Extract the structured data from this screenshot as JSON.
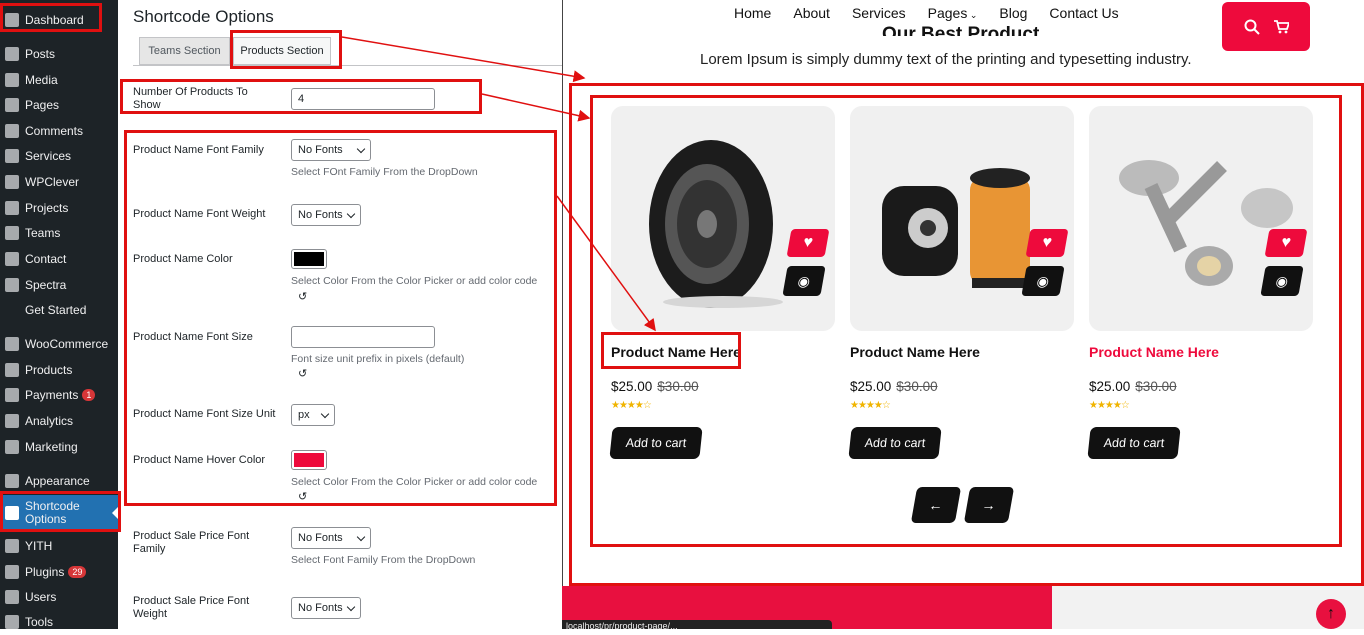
{
  "sidebar": {
    "items": [
      {
        "label": "Dashboard",
        "badge": ""
      },
      {
        "label": "Posts",
        "badge": ""
      },
      {
        "label": "Media",
        "badge": ""
      },
      {
        "label": "Pages",
        "badge": ""
      },
      {
        "label": "Comments",
        "badge": ""
      },
      {
        "label": "Services",
        "badge": ""
      },
      {
        "label": "WPClever",
        "badge": ""
      },
      {
        "label": "Projects",
        "badge": ""
      },
      {
        "label": "Teams",
        "badge": ""
      },
      {
        "label": "Contact",
        "badge": ""
      },
      {
        "label": "Spectra",
        "badge": ""
      },
      {
        "label": "Get Started",
        "badge": ""
      },
      {
        "label": "WooCommerce",
        "badge": ""
      },
      {
        "label": "Products",
        "badge": ""
      },
      {
        "label": "Payments",
        "badge": "1"
      },
      {
        "label": "Analytics",
        "badge": ""
      },
      {
        "label": "Marketing",
        "badge": ""
      },
      {
        "label": "Appearance",
        "badge": ""
      },
      {
        "label": "Shortcode Options",
        "badge": ""
      },
      {
        "label": "YITH",
        "badge": ""
      },
      {
        "label": "Plugins",
        "badge": "29"
      },
      {
        "label": "Users",
        "badge": ""
      },
      {
        "label": "Tools",
        "badge": ""
      }
    ]
  },
  "settings": {
    "title": "Shortcode Options",
    "tabs": [
      "Teams Section",
      "Products Section"
    ],
    "fields": {
      "num_products": {
        "label": "Number Of Products To Show",
        "value": "4"
      },
      "name_font_family": {
        "label": "Product Name Font Family",
        "value": "No Fonts",
        "help": "Select FOnt Family From the DropDown"
      },
      "name_font_weight": {
        "label": "Product Name Font Weight",
        "value": "No Fonts"
      },
      "name_color": {
        "label": "Product Name Color",
        "color": "#000000",
        "help": "Select Color From the Color Picker or add color code",
        "reset": "↺"
      },
      "name_font_size": {
        "label": "Product Name Font Size",
        "value": "",
        "help": "Font size unit prefix in pixels (default)",
        "reset": "↺"
      },
      "name_font_size_unit": {
        "label": "Product Name Font Size Unit",
        "value": "px"
      },
      "name_hover_color": {
        "label": "Product Name Hover Color",
        "color": "#ee0a3c",
        "help": "Select Color From the Color Picker or add color code",
        "reset": "↺"
      },
      "sale_font_family": {
        "label": "Product Sale Price Font Family",
        "value": "No Fonts",
        "help": "Select Font Family From the DropDown"
      },
      "sale_font_weight": {
        "label": "Product Sale Price Font Weight",
        "value": "No Fonts"
      }
    }
  },
  "preview": {
    "nav": [
      "Home",
      "About",
      "Services",
      "Pages",
      "Blog",
      "Contact Us"
    ],
    "nav_dropdown_icon": "chevron-down-icon",
    "section_title": "Our Best Product",
    "section_subtitle": "Lorem Ipsum is simply dummy text of the printing and typesetting industry.",
    "products": [
      {
        "name": "Product Name Here",
        "price": "$25.00",
        "old_price": "$30.00",
        "stars": "★★★★☆",
        "cart": "Add to cart",
        "name_color": "#111111"
      },
      {
        "name": "Product Name Here",
        "price": "$25.00",
        "old_price": "$30.00",
        "stars": "★★★★☆",
        "cart": "Add to cart",
        "name_color": "#111111"
      },
      {
        "name": "Product Name Here",
        "price": "$25.00",
        "old_price": "$30.00",
        "stars": "★★★★☆",
        "cart": "Add to cart",
        "name_color": "#ee0a3c"
      }
    ],
    "accent": "#ee0a3c",
    "url_hint": "localhost/pr/product-page/..."
  }
}
